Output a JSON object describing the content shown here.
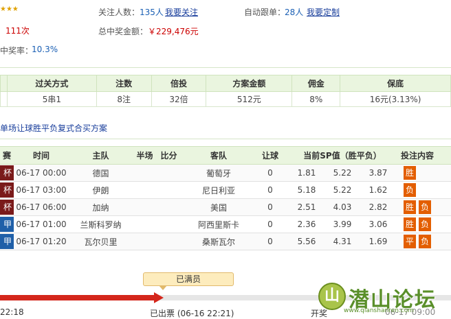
{
  "header": {
    "stars": "★★★",
    "count_value": "111次",
    "win_rate_label": "中奖率：",
    "win_rate_value": "10.3%",
    "followers_label": "关注人数：",
    "followers_value": "135人",
    "follow_link": "我要关注",
    "auto_follow_label": "自动跟单：",
    "auto_follow_value": "28人",
    "custom_link": "我要定制",
    "total_prize_label": "总中奖金额：",
    "total_prize_value": "￥229,476元"
  },
  "summary": {
    "headers": [
      "过关方式",
      "注数",
      "倍投",
      "方案金额",
      "佣金",
      "保底"
    ],
    "values": [
      "5串1",
      "8注",
      "32倍",
      "512元",
      "8%",
      "16元(3.13%)"
    ]
  },
  "section_title": "单场让球胜平负复式合买方案",
  "matches": {
    "headers": [
      "赛",
      "时间",
      "主队",
      "半场",
      "比分",
      "客队",
      "让球",
      "当前SP值（胜平负）",
      "投注内容"
    ],
    "rows": [
      {
        "league": "杯",
        "league_color": "#7a1a1a",
        "time": "06-17 00:00",
        "home": "德国",
        "half": "",
        "score": "",
        "away": "葡萄牙",
        "handicap": "0",
        "sp1": "1.81",
        "sp2": "5.22",
        "sp3": "3.87",
        "bets": [
          "胜"
        ]
      },
      {
        "league": "杯",
        "league_color": "#7a1a1a",
        "time": "06-17 03:00",
        "home": "伊朗",
        "half": "",
        "score": "",
        "away": "尼日利亚",
        "handicap": "0",
        "sp1": "5.18",
        "sp2": "5.22",
        "sp3": "1.62",
        "bets": [
          "负"
        ]
      },
      {
        "league": "杯",
        "league_color": "#7a1a1a",
        "time": "06-17 06:00",
        "home": "加纳",
        "half": "",
        "score": "",
        "away": "美国",
        "handicap": "0",
        "sp1": "2.51",
        "sp2": "4.03",
        "sp3": "2.82",
        "bets": [
          "胜",
          "负"
        ]
      },
      {
        "league": "甲",
        "league_color": "#1f5fa8",
        "time": "06-17 01:00",
        "home": "兰斯科罗纳",
        "half": "",
        "score": "",
        "away": "阿西里斯卡",
        "handicap": "0",
        "sp1": "2.36",
        "sp2": "3.99",
        "sp3": "3.06",
        "bets": [
          "胜",
          "负"
        ]
      },
      {
        "league": "甲",
        "league_color": "#1f5fa8",
        "time": "06-17 01:20",
        "home": "瓦尔贝里",
        "half": "",
        "score": "",
        "away": "桑斯瓦尔",
        "handicap": "0",
        "sp1": "5.56",
        "sp2": "4.31",
        "sp3": "1.69",
        "bets": [
          "平",
          "负"
        ]
      }
    ]
  },
  "progress": {
    "bubble": "已满员",
    "start_time": "22:18",
    "ticket_label": "已出票 (06-16 22:21)",
    "draw_label": "开奖",
    "draw_time": "06-17 09:00",
    "fill_fraction": 0.345
  },
  "watermark": {
    "text": "潜山论坛",
    "url": "www.qianshanren.com",
    "logo": "山"
  },
  "colors": {
    "accent_red": "#d4261b",
    "bet_orange": "#e35e00",
    "header_green": "#eaf5df"
  }
}
